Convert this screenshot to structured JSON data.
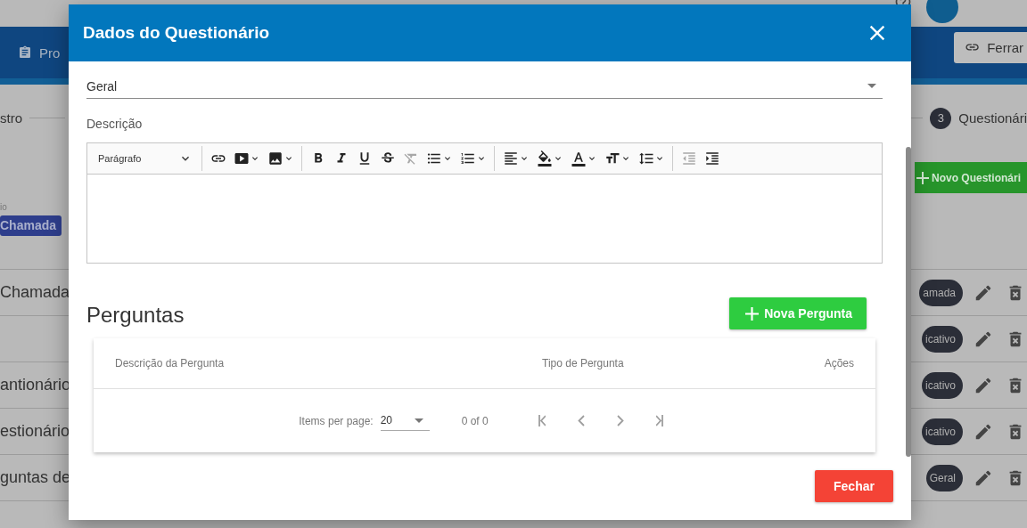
{
  "background": {
    "nav_item": "Pro",
    "tools_button": "Ferrar",
    "steps": [
      {
        "label": "stro"
      },
      {
        "number": "3",
        "label": "Questionári"
      }
    ],
    "new_button": "Novo Questionári",
    "filter_label": "io",
    "filter_chips": [
      "Chamada"
    ],
    "rows": [
      {
        "title": "Chamada",
        "type": "amada"
      },
      {
        "type": "icativo"
      },
      {
        "title": "antionário",
        "type": "icativo"
      },
      {
        "title": "estionário",
        "type": "icativo"
      },
      {
        "title": "guntas de",
        "type": "Geral"
      }
    ]
  },
  "modal": {
    "title": "Dados do Questionário",
    "category": "Geral",
    "description_label": "Descrição",
    "editor": {
      "format": "Parágrafo",
      "tools": [
        {
          "kind": "link",
          "dropdown": false,
          "disabled": false,
          "group_start": true
        },
        {
          "kind": "video",
          "dropdown": true,
          "disabled": false,
          "group_start": false
        },
        {
          "kind": "image",
          "dropdown": true,
          "disabled": false,
          "group_start": false
        },
        {
          "kind": "bold",
          "dropdown": false,
          "disabled": false,
          "group_start": true
        },
        {
          "kind": "italic",
          "dropdown": false,
          "disabled": false,
          "group_start": false
        },
        {
          "kind": "underline",
          "dropdown": false,
          "disabled": false,
          "group_start": false
        },
        {
          "kind": "strikethrough",
          "dropdown": false,
          "disabled": false,
          "group_start": false
        },
        {
          "kind": "clear",
          "dropdown": false,
          "disabled": true,
          "group_start": false
        },
        {
          "kind": "bullets",
          "dropdown": true,
          "disabled": false,
          "group_start": false
        },
        {
          "kind": "numbers",
          "dropdown": true,
          "disabled": false,
          "group_start": false
        },
        {
          "kind": "align",
          "dropdown": true,
          "disabled": false,
          "group_start": true
        },
        {
          "kind": "highlight",
          "dropdown": true,
          "disabled": false,
          "group_start": false
        },
        {
          "kind": "color",
          "dropdown": true,
          "disabled": false,
          "group_start": false
        },
        {
          "kind": "size",
          "dropdown": true,
          "disabled": false,
          "group_start": false
        },
        {
          "kind": "spacing",
          "dropdown": true,
          "disabled": false,
          "group_start": false
        },
        {
          "kind": "outdent",
          "dropdown": false,
          "disabled": true,
          "group_start": true
        },
        {
          "kind": "indent",
          "dropdown": false,
          "disabled": false,
          "group_start": false
        }
      ]
    },
    "questions": {
      "heading": "Perguntas",
      "add_button": "Nova Pergunta",
      "columns": [
        "Descrição da Pergunta",
        "Tipo de Pergunta",
        "Ações"
      ],
      "items_per_page_label": "Items per page:",
      "page_size": "20",
      "range": "0 of 0",
      "nav": [
        {
          "kind": "first",
          "disabled": true
        },
        {
          "kind": "previous",
          "disabled": true
        },
        {
          "kind": "next",
          "disabled": true
        },
        {
          "kind": "last",
          "disabled": true
        }
      ]
    },
    "close_button": "Fechar"
  }
}
